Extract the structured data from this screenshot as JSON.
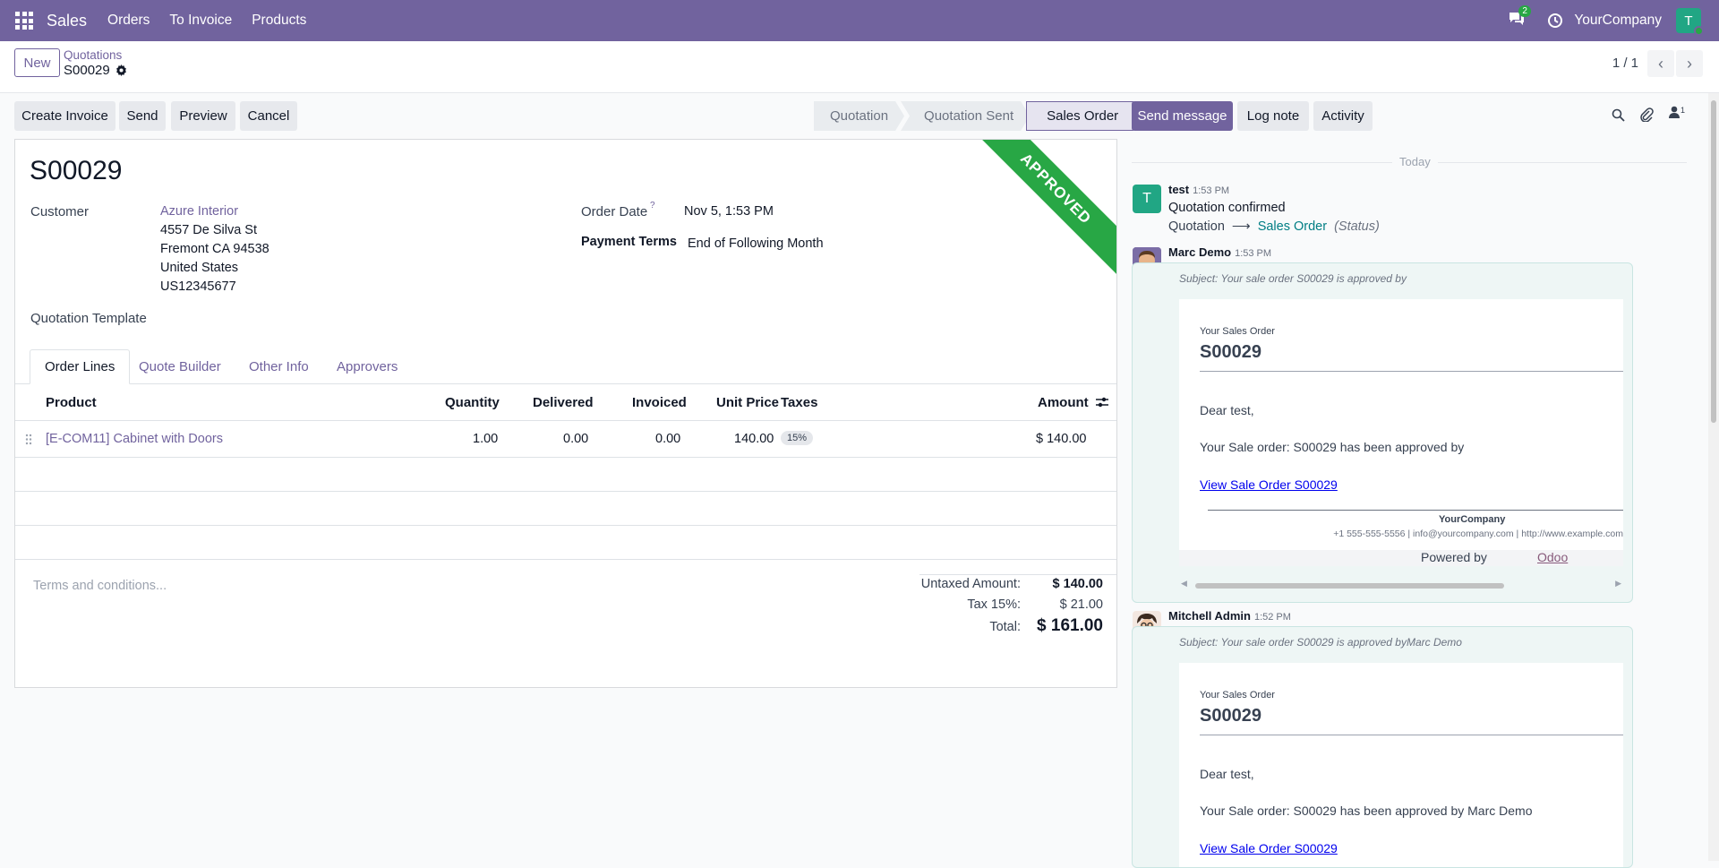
{
  "topbar": {
    "app_name": "Sales",
    "menu": [
      "Orders",
      "To Invoice",
      "Products"
    ],
    "chat_count": "2",
    "company": "YourCompany",
    "user_initial": "T"
  },
  "control": {
    "new_label": "New",
    "breadcrumb_parent": "Quotations",
    "breadcrumb_current": "S00029",
    "pager": "1 / 1"
  },
  "actions": {
    "create_invoice": "Create Invoice",
    "send": "Send",
    "preview": "Preview",
    "cancel": "Cancel"
  },
  "status": {
    "steps": [
      "Quotation",
      "Quotation Sent",
      "Sales Order"
    ],
    "active": "Sales Order"
  },
  "form": {
    "ribbon": "APPROVED",
    "title": "S00029",
    "customer_label": "Customer",
    "customer_name": "Azure Interior",
    "address": [
      "4557 De Silva St",
      "Fremont CA 94538",
      "United States",
      "US12345677"
    ],
    "template_label": "Quotation Template",
    "order_date_label": "Order Date",
    "order_date_help": "?",
    "order_date": "Nov 5, 1:53 PM",
    "payment_terms_label": "Payment Terms",
    "payment_terms": "End of Following Month"
  },
  "tabs": [
    "Order Lines",
    "Quote Builder",
    "Other Info",
    "Approvers"
  ],
  "table": {
    "headers": {
      "product": "Product",
      "quantity": "Quantity",
      "delivered": "Delivered",
      "invoiced": "Invoiced",
      "unit_price": "Unit Price",
      "taxes": "Taxes",
      "amount": "Amount"
    },
    "rows": [
      {
        "product": "[E-COM11] Cabinet with Doors",
        "quantity": "1.00",
        "delivered": "0.00",
        "invoiced": "0.00",
        "unit_price": "140.00",
        "taxes": "15%",
        "amount": "$ 140.00"
      }
    ]
  },
  "terms_placeholder": "Terms and conditions...",
  "totals": {
    "untaxed_label": "Untaxed Amount:",
    "untaxed": "$ 140.00",
    "tax_label": "Tax 15%:",
    "tax": "$ 21.00",
    "total_label": "Total:",
    "total": "$ 161.00"
  },
  "chatter": {
    "send_message": "Send message",
    "log_note": "Log note",
    "activity": "Activity",
    "follower_count": "1",
    "date_sep": "Today",
    "messages": [
      {
        "author": "test",
        "time": "1:53 PM",
        "initial": "T",
        "body": "Quotation confirmed",
        "track_old": "Quotation",
        "track_new": "Sales Order",
        "track_field": "(Status)"
      },
      {
        "author": "Marc Demo",
        "time": "1:53 PM",
        "subject": "Subject: Your sale order S00029 is approved by",
        "small": "Your Sales Order",
        "so": "S00029",
        "greeting": "Dear test,",
        "text": "Your Sale order: S00029 has been approved by",
        "link": "View Sale Order S00029",
        "company": "YourCompany",
        "contact": "+1 555-555-5556 | info@yourcompany.com | http://www.example.com",
        "powered": "Powered by",
        "powered_link": "Odoo"
      },
      {
        "author": "Mitchell Admin",
        "time": "1:52 PM",
        "subject": "Subject: Your sale order S00029 is approved byMarc Demo",
        "small": "Your Sales Order",
        "so": "S00029",
        "greeting": "Dear test,",
        "text": "Your Sale order: S00029 has been approved by Marc Demo",
        "link": "View Sale Order S00029"
      }
    ]
  }
}
